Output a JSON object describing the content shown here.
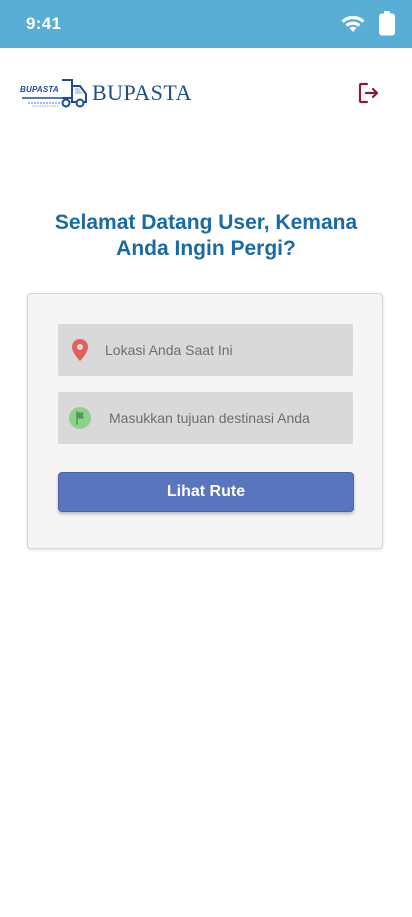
{
  "status_bar": {
    "time": "9:41",
    "icons": [
      "wifi-icon",
      "battery-icon"
    ]
  },
  "header": {
    "logo_badge": "BUPASTA",
    "logo_text": "BUPASTA",
    "logout_icon": "logout-icon"
  },
  "welcome": {
    "line1": "Selamat Datang User, Kemana",
    "line2": "Anda Ingin Pergi?"
  },
  "form": {
    "origin_placeholder": "Lokasi Anda Saat Ini",
    "origin_value": "",
    "destination_placeholder": "Masukkan tujuan destinasi Anda",
    "destination_value": "",
    "submit_label": "Lihat Rute",
    "origin_icon": "map-pin-icon",
    "destination_icon": "flag-icon"
  },
  "colors": {
    "status_bar": "#5aaed6",
    "brand_blue": "#1d4e89",
    "heading": "#1a6aa6",
    "button": "#5b74be",
    "logout": "#8a1c3b",
    "pin": "#e06060",
    "flag": "#8fcf8f"
  }
}
